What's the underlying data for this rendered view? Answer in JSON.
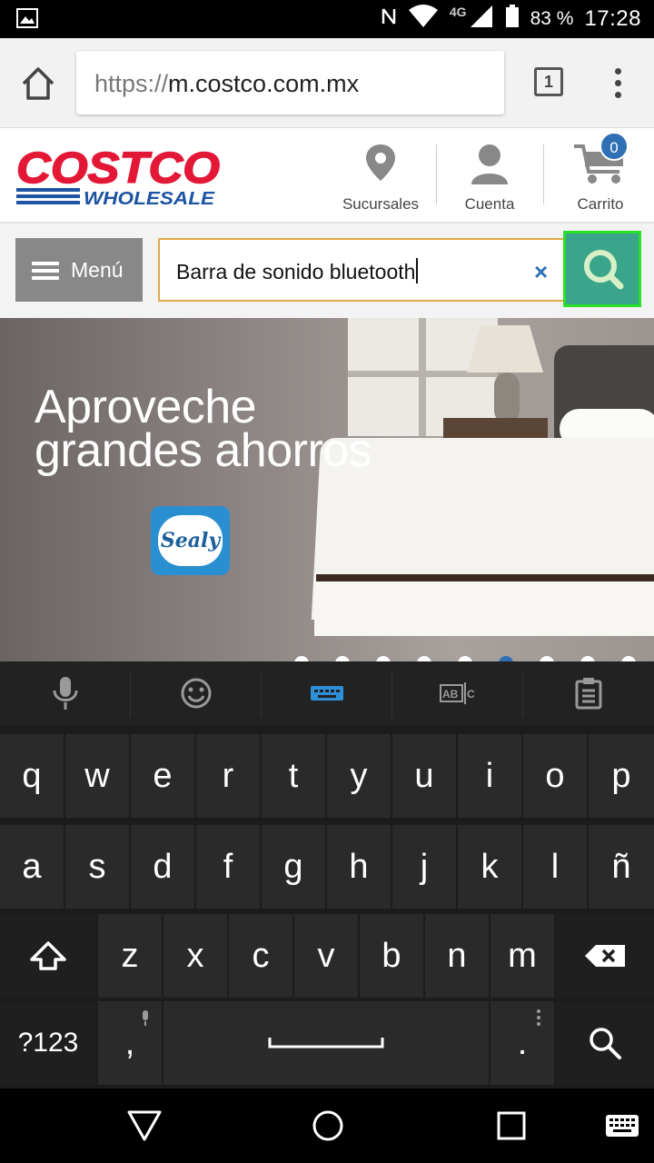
{
  "status_bar": {
    "battery": "83 %",
    "time": "17:28",
    "network": "4G"
  },
  "browser": {
    "url_scheme": "https://",
    "url_host": "m.costco.com.mx",
    "tab_count": "1"
  },
  "header": {
    "logo_text": "COSTCO",
    "logo_sub": "WHOLESALE",
    "sucursales_label": "Sucursales",
    "cuenta_label": "Cuenta",
    "carrito_label": "Carrito",
    "cart_count": "0"
  },
  "search": {
    "menu_label": "Menú",
    "query": "Barra de sonido bluetooth",
    "clear_label": "×"
  },
  "banner": {
    "headline_line1": "Aproveche",
    "headline_line2": "grandes ahorros",
    "brand": "Sealy"
  },
  "keyboard": {
    "row1": [
      "q",
      "w",
      "e",
      "r",
      "t",
      "y",
      "u",
      "i",
      "o",
      "p"
    ],
    "row2": [
      "a",
      "s",
      "d",
      "f",
      "g",
      "h",
      "j",
      "k",
      "l",
      "ñ"
    ],
    "row3": [
      "z",
      "x",
      "c",
      "v",
      "b",
      "n",
      "m"
    ],
    "symbols_key": "?123",
    "comma_key": ",",
    "period_key": "."
  },
  "colors": {
    "costco_red": "#e31837",
    "costco_blue": "#1d54a3",
    "search_green": "#3aa58a",
    "cart_badge_blue": "#2f6fb4",
    "input_border": "#e1a94a"
  }
}
